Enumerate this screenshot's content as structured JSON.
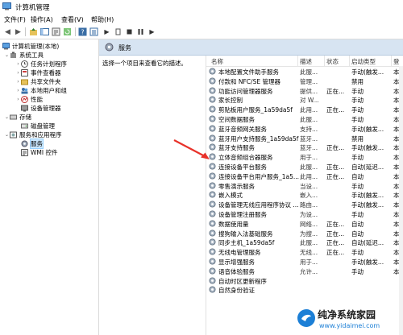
{
  "window": {
    "title": "计算机管理"
  },
  "menu": [
    "文件(F)",
    "操作(A)",
    "查看(V)",
    "帮助(H)"
  ],
  "tree": {
    "root": "计算机管理(本地)",
    "system_tools": "系统工具",
    "task_scheduler": "任务计划程序",
    "event_viewer": "事件查看器",
    "shared_folders": "共享文件夹",
    "local_users": "本地用户和组",
    "performance": "性能",
    "device_manager": "设备管理器",
    "storage": "存储",
    "disk_management": "磁盘管理",
    "services_apps": "服务和应用程序",
    "services": "服务",
    "wmi": "WMI 控件"
  },
  "pane": {
    "title": "服务",
    "description_prompt": "选择一个项目来查看它的描述。"
  },
  "columns": {
    "name": "名称",
    "desc": "描述",
    "status": "状态",
    "start": "启动类型",
    "logon": "登"
  },
  "services": [
    {
      "name": "本地配置文件助手服务",
      "desc": "此服...",
      "status": "",
      "start": "手动(触发...",
      "logon": "本"
    },
    {
      "name": "付款和 NFC/SE 管理器",
      "desc": "管理...",
      "status": "",
      "start": "禁用",
      "logon": "本"
    },
    {
      "name": "功能访问管理器服务",
      "desc": "提供...",
      "status": "正在...",
      "start": "手动",
      "logon": "本"
    },
    {
      "name": "家长控制",
      "desc": "对 W...",
      "status": "",
      "start": "手动",
      "logon": "本"
    },
    {
      "name": "剪贴板用户服务_1a59da5f",
      "desc": "此用...",
      "status": "正在...",
      "start": "手动",
      "logon": "本"
    },
    {
      "name": "空间数据服务",
      "desc": "此服...",
      "status": "",
      "start": "手动",
      "logon": "本"
    },
    {
      "name": "蓝牙音频网关服务",
      "desc": "支持...",
      "status": "",
      "start": "手动(触发...",
      "logon": "本"
    },
    {
      "name": "蓝牙用户支持服务_1a59da5f",
      "desc": "蓝牙...",
      "status": "",
      "start": "禁用",
      "logon": "本"
    },
    {
      "name": "蓝牙支持服务",
      "desc": "蓝牙...",
      "status": "正在...",
      "start": "手动(触发...",
      "logon": "本"
    },
    {
      "name": "立体音频组合器服务",
      "desc": "用于...",
      "status": "",
      "start": "手动",
      "logon": "本"
    },
    {
      "name": "连接设备平台服务",
      "desc": "此服...",
      "status": "正在...",
      "start": "自动(延迟...",
      "logon": "本"
    },
    {
      "name": "连接设备平台用户服务_1a5...",
      "desc": "此用...",
      "status": "正在...",
      "start": "自动",
      "logon": "本"
    },
    {
      "name": "零售演示服务",
      "desc": "当设...",
      "status": "",
      "start": "手动",
      "logon": "本"
    },
    {
      "name": "嵌入模式",
      "desc": "嵌入...",
      "status": "",
      "start": "手动(触发...",
      "logon": "本"
    },
    {
      "name": "设备管理无线应用程序协议 ...",
      "desc": "路由...",
      "status": "",
      "start": "手动(触发...",
      "logon": "本"
    },
    {
      "name": "设备管理注册服务",
      "desc": "为设...",
      "status": "",
      "start": "手动",
      "logon": "本"
    },
    {
      "name": "数据使用量",
      "desc": "网络...",
      "status": "正在...",
      "start": "自动",
      "logon": "本"
    },
    {
      "name": "搜狗输入法基础服务",
      "desc": "为搜...",
      "status": "正在...",
      "start": "自动",
      "logon": "本"
    },
    {
      "name": "同步主机_1a59da5f",
      "desc": "此服...",
      "status": "正在...",
      "start": "自动(延迟...",
      "logon": "本"
    },
    {
      "name": "无线电管理服务",
      "desc": "无线...",
      "status": "正在...",
      "start": "手动",
      "logon": "本"
    },
    {
      "name": "显示增强服务",
      "desc": "用于...",
      "status": "",
      "start": "手动(触发...",
      "logon": "本"
    },
    {
      "name": "语音体验服务",
      "desc": "允许...",
      "status": "",
      "start": "手动",
      "logon": "本"
    },
    {
      "name": "自动时区更新程序",
      "desc": "",
      "status": "",
      "start": "",
      "logon": ""
    },
    {
      "name": "自然身份验证",
      "desc": "",
      "status": "",
      "start": "",
      "logon": ""
    }
  ],
  "watermark": {
    "title": "纯净系统家园",
    "url": "www.yidaimei.com"
  },
  "colors": {
    "accent": "#1c7fd6",
    "arrow": "#e8322a",
    "header_band": "#d7e4f2"
  }
}
